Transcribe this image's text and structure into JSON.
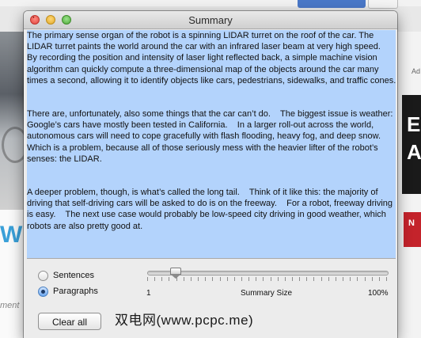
{
  "window": {
    "title": "Summary"
  },
  "summary": {
    "paragraphs": [
      "The primary sense organ of the robot is a spinning LIDAR turret on the roof of the car. The LIDAR turret paints the world around the car with an infrared laser beam at very high speed.    By recording the position and intensity of laser light reflected back, a simple machine vision algorithm can quickly compute a three-dimensional map of the objects around the car many times a second, allowing it to identify objects like cars, pedestrians, sidewalks, and traffic cones.",
      "There are, unfortunately, also some things that the car can’t do.    The biggest issue is weather: Google’s cars have mostly been tested in California.    In a larger roll-out across the world, autonomous cars will need to cope gracefully with flash flooding, heavy fog, and deep snow.    Which is a problem, because all of those seriously mess with the heavier lifter of the robot’s senses: the LIDAR.",
      "A deeper problem, though, is what’s called the long tail.    Think of it like this: the majority of driving that self-driving cars will be asked to do is on the freeway.    For a robot, freeway driving is easy.    The next use case would probably be low-speed city driving in good weather, which robots are also pretty good at."
    ],
    "selected": true
  },
  "controls": {
    "sentences_label": "Sentences",
    "paragraphs_label": "Paragraphs",
    "selected_mode": "Paragraphs",
    "slider_min_label": "1",
    "slider_title": "Summary Size",
    "slider_max_label": "100%",
    "slider_value_fraction": 0.12,
    "clear_all_label": "Clear all"
  },
  "watermark": {
    "text": "双电网(www.pcpc.me)"
  },
  "background_page": {
    "left_letter": "W",
    "left_italic": "ment",
    "right_ad_letters": [
      "E",
      "A"
    ],
    "right_red_letter": "N",
    "right_small_text": "Ad"
  },
  "colors": {
    "selection_highlight": "#b3d3fc",
    "window_background": "#ececec",
    "radio_selected": "#6aa6ee"
  }
}
